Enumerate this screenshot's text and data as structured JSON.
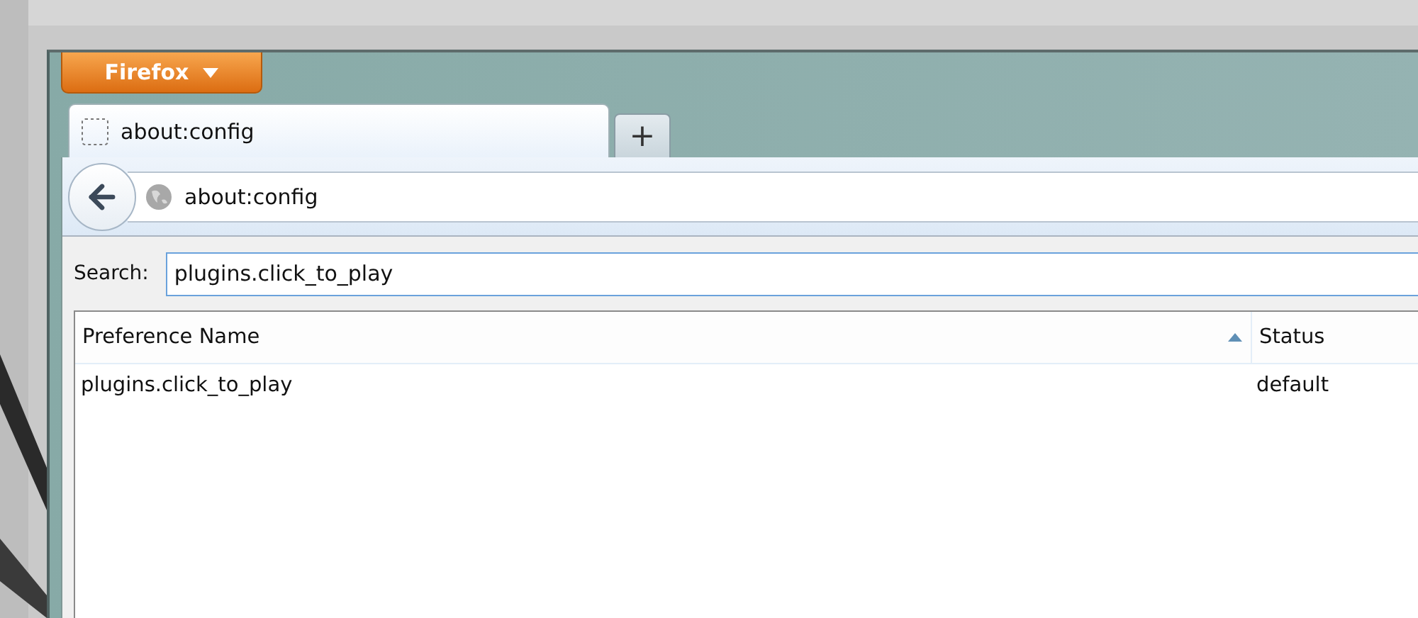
{
  "window": {
    "menu_button": "Firefox"
  },
  "tabs": [
    {
      "title": "about:config",
      "selected": true
    }
  ],
  "new_tab_button": "+",
  "address_bar": {
    "value": "about:config"
  },
  "search": {
    "label": "Search:",
    "value": "plugins.click_to_play"
  },
  "table": {
    "columns": [
      {
        "label": "Preference Name",
        "sorted": true
      },
      {
        "label": "Status",
        "sorted": false
      }
    ],
    "rows": [
      {
        "cells": [
          "plugins.click_to_play",
          "default"
        ]
      }
    ]
  }
}
